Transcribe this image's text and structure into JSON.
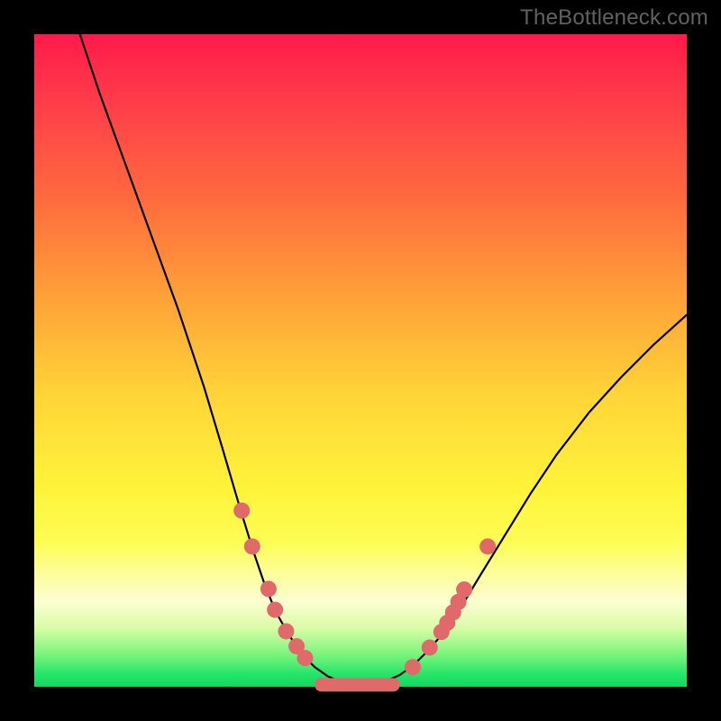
{
  "watermark": "TheBottleneck.com",
  "chart_data": {
    "type": "line",
    "title": "",
    "xlabel": "",
    "ylabel": "",
    "xlim": [
      0,
      100
    ],
    "ylim": [
      0,
      100
    ],
    "grid": false,
    "legend": false,
    "background_gradient": {
      "top": "#ff1a4a",
      "middle": "#ffd438",
      "bottom": "#14d760"
    },
    "series": [
      {
        "name": "left-curve",
        "stroke": "#000000",
        "x": [
          7,
          10,
          14,
          18,
          22,
          26,
          29,
          31.5,
          33.5,
          35.2,
          37,
          39,
          41,
          43,
          45,
          47,
          48.5,
          50
        ],
        "y": [
          100,
          91,
          80,
          69,
          58,
          46,
          36,
          27.5,
          21,
          16,
          11.5,
          8,
          5,
          3,
          1.6,
          0.7,
          0.3,
          0.15
        ]
      },
      {
        "name": "right-curve",
        "stroke": "#000000",
        "x": [
          50,
          52,
          54,
          56,
          58,
          60,
          62.5,
          65,
          68,
          72,
          76,
          80,
          85,
          90,
          95,
          100
        ],
        "y": [
          0.15,
          0.3,
          0.9,
          1.8,
          3.2,
          5.2,
          8,
          11.5,
          16.5,
          23,
          29.5,
          35.5,
          42,
          47.5,
          52.5,
          57
        ]
      },
      {
        "name": "valley-floor",
        "stroke": "#e06a6a",
        "stroke_width": 15,
        "x": [
          44,
          55
        ],
        "y": [
          0.3,
          0.3
        ]
      }
    ],
    "markers": [
      {
        "name": "left-dots",
        "color": "#e06a6a",
        "radius": 9,
        "points": [
          {
            "x": 31.8,
            "y": 27
          },
          {
            "x": 33.4,
            "y": 21.5
          },
          {
            "x": 35.9,
            "y": 15
          },
          {
            "x": 36.9,
            "y": 11.8
          },
          {
            "x": 38.6,
            "y": 8.5
          },
          {
            "x": 40.2,
            "y": 6.2
          },
          {
            "x": 41.5,
            "y": 4.4
          }
        ]
      },
      {
        "name": "right-dots",
        "color": "#e06a6a",
        "radius": 9,
        "points": [
          {
            "x": 58.0,
            "y": 3.0
          },
          {
            "x": 60.6,
            "y": 6.0
          },
          {
            "x": 62.4,
            "y": 8.4
          },
          {
            "x": 63.3,
            "y": 9.8
          },
          {
            "x": 64.2,
            "y": 11.4
          },
          {
            "x": 65.0,
            "y": 13.0
          },
          {
            "x": 65.9,
            "y": 14.9
          },
          {
            "x": 69.5,
            "y": 21.5
          }
        ]
      }
    ]
  }
}
